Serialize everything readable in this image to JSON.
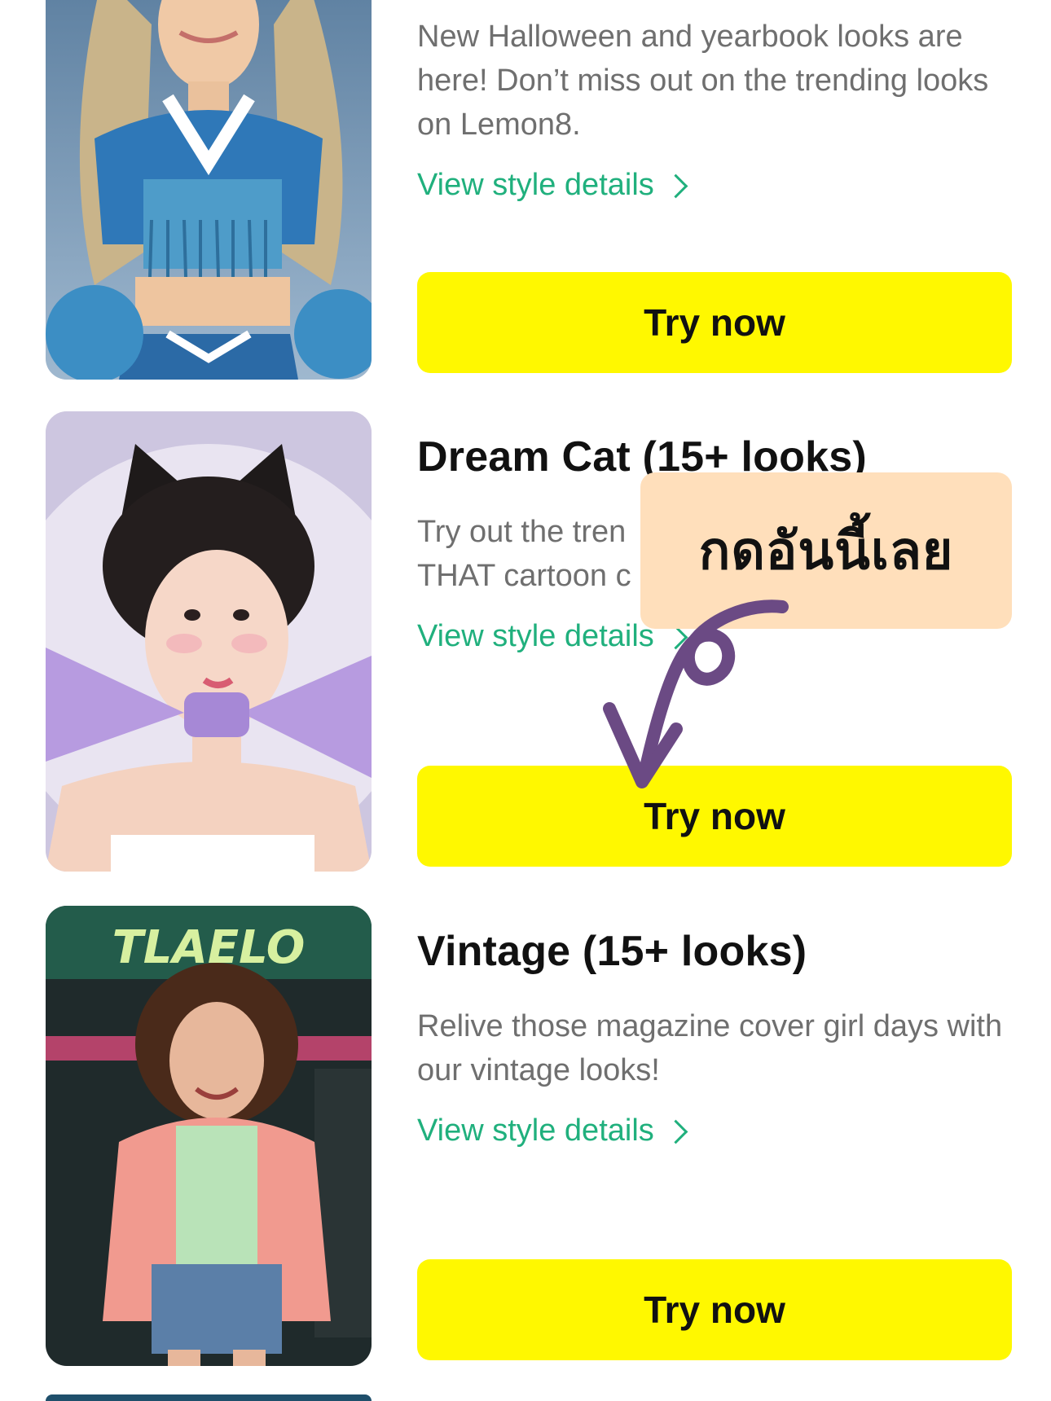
{
  "cards": [
    {
      "title": "",
      "description": "New Halloween and yearbook looks are here! Don’t miss out on the trending looks on Lemon8.",
      "details_label": "View style details",
      "button_label": "Try now",
      "image": "cheerleader-portrait"
    },
    {
      "title": "Dream Cat (15+ looks)",
      "description": "Try out the tren THAT cartoon c",
      "details_label": "View style details",
      "button_label": "Try now",
      "image": "cat-ear-hair-portrait"
    },
    {
      "title": "Vintage (15+ looks)",
      "description": "Relive those magazine cover girl days with our vintage looks!",
      "details_label": "View style details",
      "button_label": "Try now",
      "image": "vintage-neon-portrait",
      "sign_text": "TLAELO"
    }
  ],
  "annotation": {
    "text": "กดอันนี้เลย"
  },
  "colors": {
    "accent_green": "#20b07d",
    "button_yellow": "#fff800",
    "annotation_bg": "#ffdfbb",
    "arrow_purple": "#6b4a84"
  },
  "icons": {
    "chevron": "chevron-right-icon",
    "arrow": "curved-arrow-icon"
  }
}
